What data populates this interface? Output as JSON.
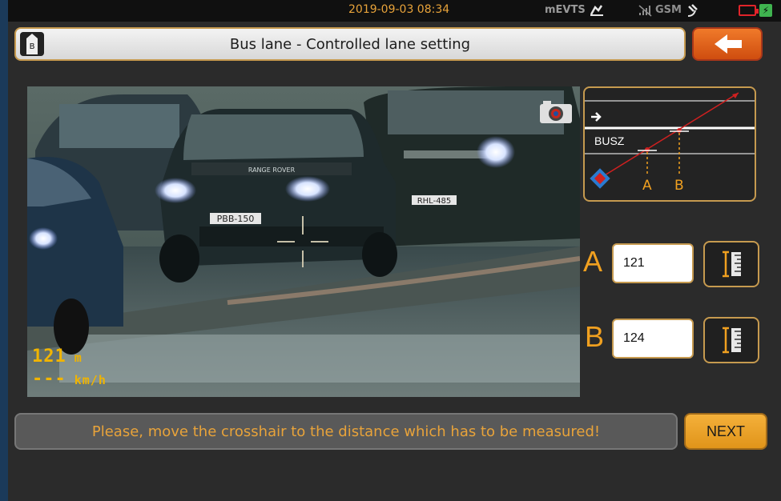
{
  "status": {
    "datetime": "2019-09-03 08:34",
    "service": "mEVTS",
    "network": "GSM",
    "icons": [
      "sign-icon",
      "no-signal-icon",
      "satellite-icon",
      "battery-low-icon",
      "charging-icon"
    ],
    "charge_glyph": "⚡"
  },
  "header": {
    "badge_letter": "B",
    "title": "Bus lane - Controlled lane setting",
    "back_icon": "arrow-left-icon"
  },
  "camera": {
    "plates": [
      "PBB-150",
      "RHL-485"
    ],
    "distance_value": "121",
    "distance_unit": "m",
    "speed_value": "---",
    "speed_unit": "km/h",
    "camera_icon": "camera-icon"
  },
  "lane_diagram": {
    "lane_label": "BUSZ",
    "point_a": "A",
    "point_b": "B"
  },
  "points": {
    "a": {
      "label": "A",
      "value": "121",
      "tool_icon": "ruler-icon"
    },
    "b": {
      "label": "B",
      "value": "124",
      "tool_icon": "ruler-icon"
    }
  },
  "message": "Please, move the crosshair to the distance which has to be measured!",
  "next_label": "NEXT",
  "colors": {
    "accent": "#e8a33a",
    "back_button": "#e0601a",
    "border": "#c69a4f"
  }
}
